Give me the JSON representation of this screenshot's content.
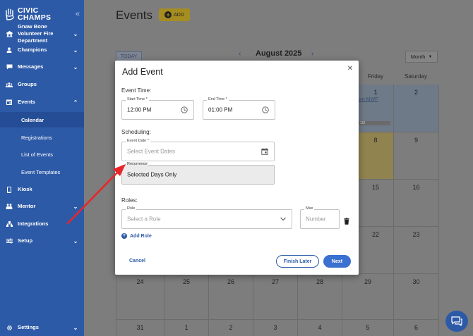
{
  "sidebar": {
    "logo_text": "CIVIC CHAMPS",
    "org_name": "Gnaw Bone Volunteer Fire Department",
    "items": [
      {
        "label": "Champions",
        "icon": "person-icon"
      },
      {
        "label": "Messages",
        "icon": "message-icon"
      },
      {
        "label": "Groups",
        "icon": "groups-icon"
      },
      {
        "label": "Events",
        "icon": "calendar-icon"
      },
      {
        "label": "Kiosk",
        "icon": "kiosk-icon"
      },
      {
        "label": "Mentor",
        "icon": "mentor-icon"
      },
      {
        "label": "Integrations",
        "icon": "integrations-icon"
      },
      {
        "label": "Setup",
        "icon": "setup-icon"
      },
      {
        "label": "Settings",
        "icon": "gear-icon"
      }
    ],
    "events_sub": [
      "Calendar",
      "Registrations",
      "List of Events",
      "Event Templates"
    ],
    "active_sub": "Calendar"
  },
  "main": {
    "title": "Events",
    "add_label": "ADD",
    "today_label": "TODAY",
    "month": "August 2025",
    "view": "Month",
    "weekdays": {
      "fri": "Friday",
      "sat": "Saturday"
    },
    "event_link": "om MWF",
    "event_bar": "1/3",
    "dates": {
      "row1": [
        "1",
        "2"
      ],
      "row2": [
        "8",
        "9"
      ],
      "row3": [
        "15",
        "16"
      ],
      "row4": [
        "22",
        "23"
      ],
      "row5": [
        "24",
        "25",
        "26",
        "27",
        "28",
        "29",
        "30"
      ],
      "row6": [
        "31",
        "1",
        "2",
        "3",
        "4",
        "5",
        "6"
      ]
    }
  },
  "modal": {
    "title": "Add Event",
    "event_time_label": "Event Time:",
    "start_time": {
      "label": "Start Time *",
      "value": "12:00 PM"
    },
    "end_time": {
      "label": "End Time *",
      "value": "01:00 PM"
    },
    "scheduling_label": "Scheduling:",
    "event_date": {
      "label": "Event Date *",
      "placeholder": "Select Event Dates"
    },
    "recurrence": {
      "label": "Recurrence",
      "value": "Selected Days Only"
    },
    "roles_label": "Roles:",
    "role": {
      "label": "Role",
      "placeholder": "Select a Role"
    },
    "max": {
      "label": "Max",
      "placeholder": "Number"
    },
    "add_role": "Add Role",
    "cancel": "Cancel",
    "finish_later": "Finish Later",
    "next": "Next"
  },
  "colors": {
    "sidebar": "#2d5aa7",
    "primary": "#3a70d0",
    "add_button": "#d4b52c",
    "annotation_arrow": "#e8262a"
  }
}
